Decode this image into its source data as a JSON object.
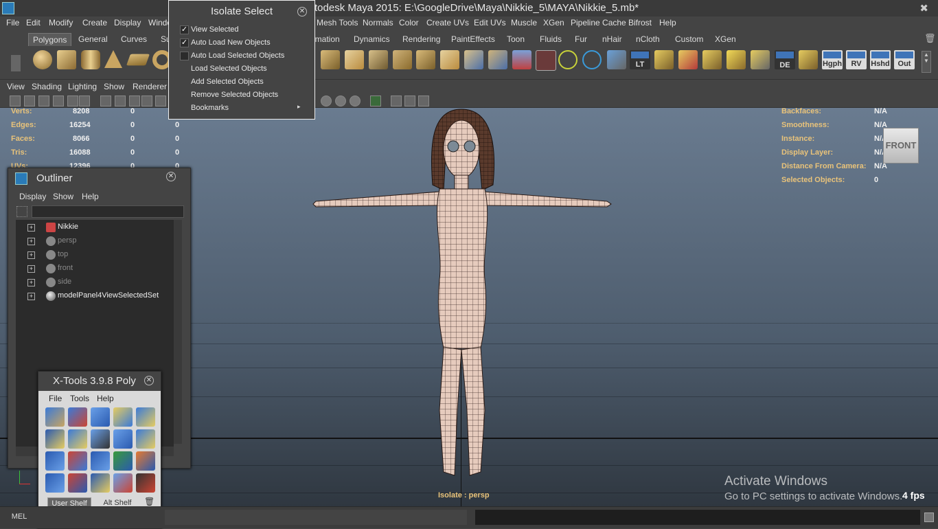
{
  "window": {
    "title": "todesk Maya 2015: E:\\GoogleDrive\\Maya\\Nikkie_5\\MAYA\\Nikkie_5.mb*"
  },
  "menubar": [
    "File",
    "Edit",
    "Modify",
    "Create",
    "Display",
    "Windo",
    "Mesh Tools",
    "Normals",
    "Color",
    "Create UVs",
    "Edit UVs",
    "Muscle",
    "XGen",
    "Pipeline Cache",
    "Bifrost",
    "Help"
  ],
  "shelf_tabs": [
    "Polygons",
    "General",
    "Curves",
    "Su",
    "imation",
    "Dynamics",
    "Rendering",
    "PaintEffects",
    "Toon",
    "Fluids",
    "Fur",
    "nHair",
    "nCloth",
    "Custom",
    "XGen"
  ],
  "shelf_text_icons": [
    "LT",
    "DE",
    "Hgph",
    "RV",
    "Hshd",
    "Out"
  ],
  "viewport": {
    "menu": [
      "View",
      "Shading",
      "Lighting",
      "Show",
      "Renderer"
    ],
    "stats": [
      {
        "label": "Verts:",
        "v1": "8208",
        "v2": "0",
        "v3": "0"
      },
      {
        "label": "Edges:",
        "v1": "16254",
        "v2": "0",
        "v3": "0"
      },
      {
        "label": "Faces:",
        "v1": "8066",
        "v2": "0",
        "v3": "0"
      },
      {
        "label": "Tris:",
        "v1": "16088",
        "v2": "0",
        "v3": "0"
      },
      {
        "label": "UVs:",
        "v1": "12396",
        "v2": "0",
        "v3": "0"
      }
    ],
    "hud_right": [
      {
        "label": "Backfaces:",
        "value": "N/A"
      },
      {
        "label": "Smoothness:",
        "value": "N/A"
      },
      {
        "label": "Instance:",
        "value": "N/A"
      },
      {
        "label": "Display Layer:",
        "value": "N/A"
      },
      {
        "label": "Distance From Camera:",
        "value": "N/A"
      },
      {
        "label": "Selected Objects:",
        "value": "0"
      }
    ],
    "view_cube": "FRONT",
    "isolate_label": "Isolate : persp",
    "fps": "4 fps",
    "watermark_title": "Activate Windows",
    "watermark_sub": "Go to PC settings to activate Windows."
  },
  "isolate_popup": {
    "title": "Isolate Select",
    "items": [
      {
        "label": "View Selected",
        "checked": true
      },
      {
        "label": "Auto Load New Objects",
        "checked": true
      },
      {
        "label": "Auto Load Selected Objects",
        "checked": false
      },
      {
        "label": "Load Selected Objects"
      },
      {
        "label": "Add Selected Objects"
      },
      {
        "label": "Remove Selected Objects"
      },
      {
        "label": "Bookmarks",
        "submenu": true
      }
    ]
  },
  "outliner": {
    "title": "Outliner",
    "menu": [
      "Display",
      "Show",
      "Help"
    ],
    "items": [
      {
        "label": "Nikkie",
        "dim": false
      },
      {
        "label": "persp",
        "dim": true
      },
      {
        "label": "top",
        "dim": true
      },
      {
        "label": "front",
        "dim": true
      },
      {
        "label": "side",
        "dim": true
      },
      {
        "label": "modelPanel4ViewSelectedSet",
        "dim": false
      }
    ]
  },
  "xtools": {
    "title": "X-Tools 3.9.8 Poly",
    "menu": [
      "File",
      "Tools",
      "Help"
    ],
    "tabs": [
      "User Shelf",
      "Alt Shelf"
    ]
  },
  "command_line": {
    "mode": "MEL"
  },
  "colors": {
    "hud_label": "#e9c37a",
    "accent": "#3f74b8"
  }
}
